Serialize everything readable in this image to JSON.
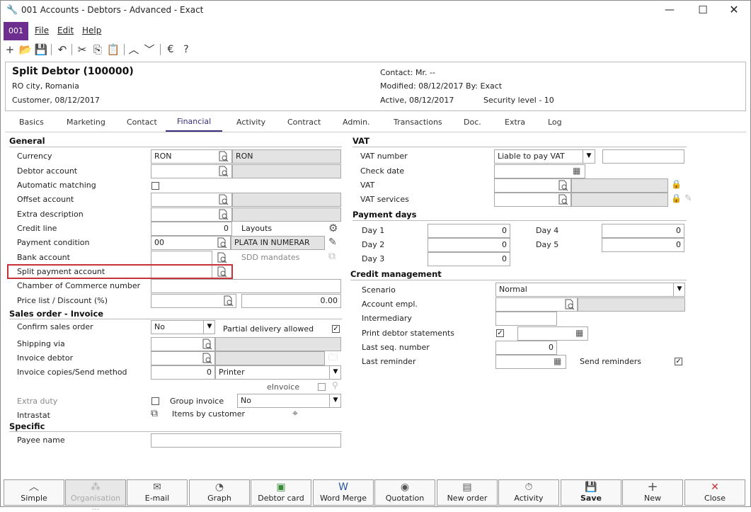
{
  "window": {
    "title": "001 Accounts - Debtors - Advanced - Exact"
  },
  "menu": {
    "logo": "001",
    "file": "File",
    "edit": "Edit",
    "help": "Help"
  },
  "header": {
    "name": "Split Debtor (100000)",
    "city": "RO city, Romania",
    "customer": "Customer, 08/12/2017",
    "contact": "Contact: Mr. --",
    "modified": "Modified: 08/12/2017  By: Exact",
    "active": "Active, 08/12/2017",
    "security": "Security level - 10"
  },
  "tabs": [
    "Basics",
    "Marketing",
    "Contact",
    "Financial",
    "Activity",
    "Contract",
    "Admin.",
    "Transactions",
    "Doc.",
    "Extra",
    "Log"
  ],
  "general": {
    "title": "General",
    "currency": {
      "label": "Currency",
      "value": "RON",
      "desc": "RON"
    },
    "debtor_account": {
      "label": "Debtor account"
    },
    "auto_matching": {
      "label": "Automatic matching"
    },
    "offset_account": {
      "label": "Offset account"
    },
    "extra_description": {
      "label": "Extra description"
    },
    "credit_line": {
      "label": "Credit line",
      "value": "0",
      "layouts": "Layouts"
    },
    "payment_condition": {
      "label": "Payment condition",
      "value": "00",
      "desc": "PLATA IN NUMERAR"
    },
    "bank_account": {
      "label": "Bank account",
      "sdd": "SDD mandates"
    },
    "split_payment": {
      "label": "Split payment account"
    },
    "chamber": {
      "label": "Chamber of Commerce number"
    },
    "price_list": {
      "label": "Price list / Discount (%)",
      "value": "0.00"
    }
  },
  "sales": {
    "title": "Sales order - Invoice",
    "confirm": {
      "label": "Confirm sales order",
      "value": "No",
      "partial": "Partial delivery allowed"
    },
    "shipping": {
      "label": "Shipping via"
    },
    "invoice_debtor": {
      "label": "Invoice debtor"
    },
    "copies": {
      "label": "Invoice copies/Send method",
      "value": "0",
      "method": "Printer"
    },
    "einvoice": "eInvoice",
    "extra_duty": {
      "label": "Extra duty",
      "group": "Group invoice",
      "group_value": "No"
    },
    "intrastat": {
      "label": "Intrastat",
      "items": "Items by customer"
    }
  },
  "specific": {
    "title": "Specific",
    "payee": {
      "label": "Payee name"
    }
  },
  "vat": {
    "title": "VAT",
    "number": {
      "label": "VAT number",
      "value": "Liable to pay VAT"
    },
    "check_date": {
      "label": "Check date"
    },
    "vat": {
      "label": "VAT"
    },
    "services": {
      "label": "VAT services"
    }
  },
  "payment_days": {
    "title": "Payment days",
    "day1": {
      "label": "Day 1",
      "value": "0"
    },
    "day2": {
      "label": "Day 2",
      "value": "0"
    },
    "day3": {
      "label": "Day 3",
      "value": "0"
    },
    "day4": {
      "label": "Day 4",
      "value": "0"
    },
    "day5": {
      "label": "Day 5",
      "value": "0"
    }
  },
  "credit": {
    "title": "Credit management",
    "scenario": {
      "label": "Scenario",
      "value": "Normal"
    },
    "account_empl": {
      "label": "Account empl."
    },
    "intermediary": {
      "label": "Intermediary"
    },
    "print_statements": {
      "label": "Print debtor statements"
    },
    "last_seq": {
      "label": "Last seq. number",
      "value": "0"
    },
    "last_reminder": {
      "label": "Last reminder",
      "send": "Send reminders"
    }
  },
  "buttons": [
    "Simple",
    "Organisation ...",
    "E-mail",
    "Graph",
    "Debtor card",
    "Word Merge",
    "Quotation",
    "New order",
    "Activity",
    "Save",
    "New",
    "Close"
  ]
}
